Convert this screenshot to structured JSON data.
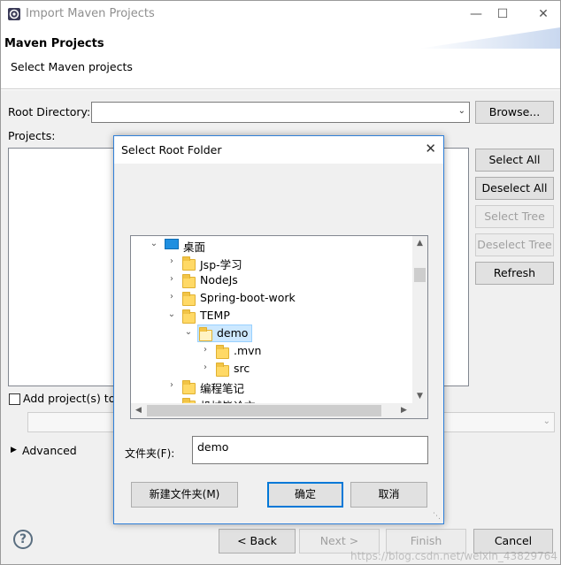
{
  "window": {
    "title": "Import Maven Projects",
    "minimize": "—",
    "maximize": "☐",
    "close": "✕"
  },
  "header": {
    "title": "Maven Projects",
    "subtitle": "Select Maven projects"
  },
  "form": {
    "root_directory_label": "Root Directory:",
    "root_directory_value": "",
    "browse_label": "Browse...",
    "projects_label": "Projects:",
    "select_all_label": "Select All",
    "deselect_all_label": "Deselect All",
    "select_tree_label": "Select Tree",
    "deselect_tree_label": "Deselect Tree",
    "refresh_label": "Refresh",
    "add_projects_label": "Add project(s) to",
    "advanced_label": "Advanced"
  },
  "footer": {
    "back_label": "< Back",
    "next_label": "Next >",
    "finish_label": "Finish",
    "cancel_label": "Cancel",
    "help_glyph": "?"
  },
  "dialog": {
    "title": "Select Root Folder",
    "close_glyph": "✕",
    "tree": [
      {
        "label": "桌面",
        "expanded": true,
        "icon": "desktop-icon"
      },
      {
        "label": "Jsp-学习",
        "expanded": false,
        "icon": "folder-icon"
      },
      {
        "label": "NodeJs",
        "expanded": false,
        "icon": "folder-icon"
      },
      {
        "label": "Spring-boot-work",
        "expanded": false,
        "icon": "folder-icon"
      },
      {
        "label": "TEMP",
        "expanded": true,
        "icon": "folder-icon"
      },
      {
        "label": "demo",
        "expanded": true,
        "selected": true,
        "icon": "folder-open-icon"
      },
      {
        "label": ".mvn",
        "expanded": false,
        "icon": "folder-icon"
      },
      {
        "label": "src",
        "expanded": false,
        "icon": "folder-icon"
      },
      {
        "label": "编程笔记",
        "expanded": false,
        "icon": "folder-icon"
      },
      {
        "label": "机械毕论文",
        "expanded": false,
        "icon": "folder-icon"
      }
    ],
    "folder_label": "文件夹(F):",
    "folder_value": "demo",
    "new_folder_label": "新建文件夹(M)",
    "ok_label": "确定",
    "cancel_label": "取消"
  },
  "watermark": "https://blog.csdn.net/weixin_43829764",
  "colors": {
    "accent": "#0078d7",
    "dialog_border": "#2f7fd8",
    "selection": "#cce8ff",
    "folder": "#ffd966"
  }
}
